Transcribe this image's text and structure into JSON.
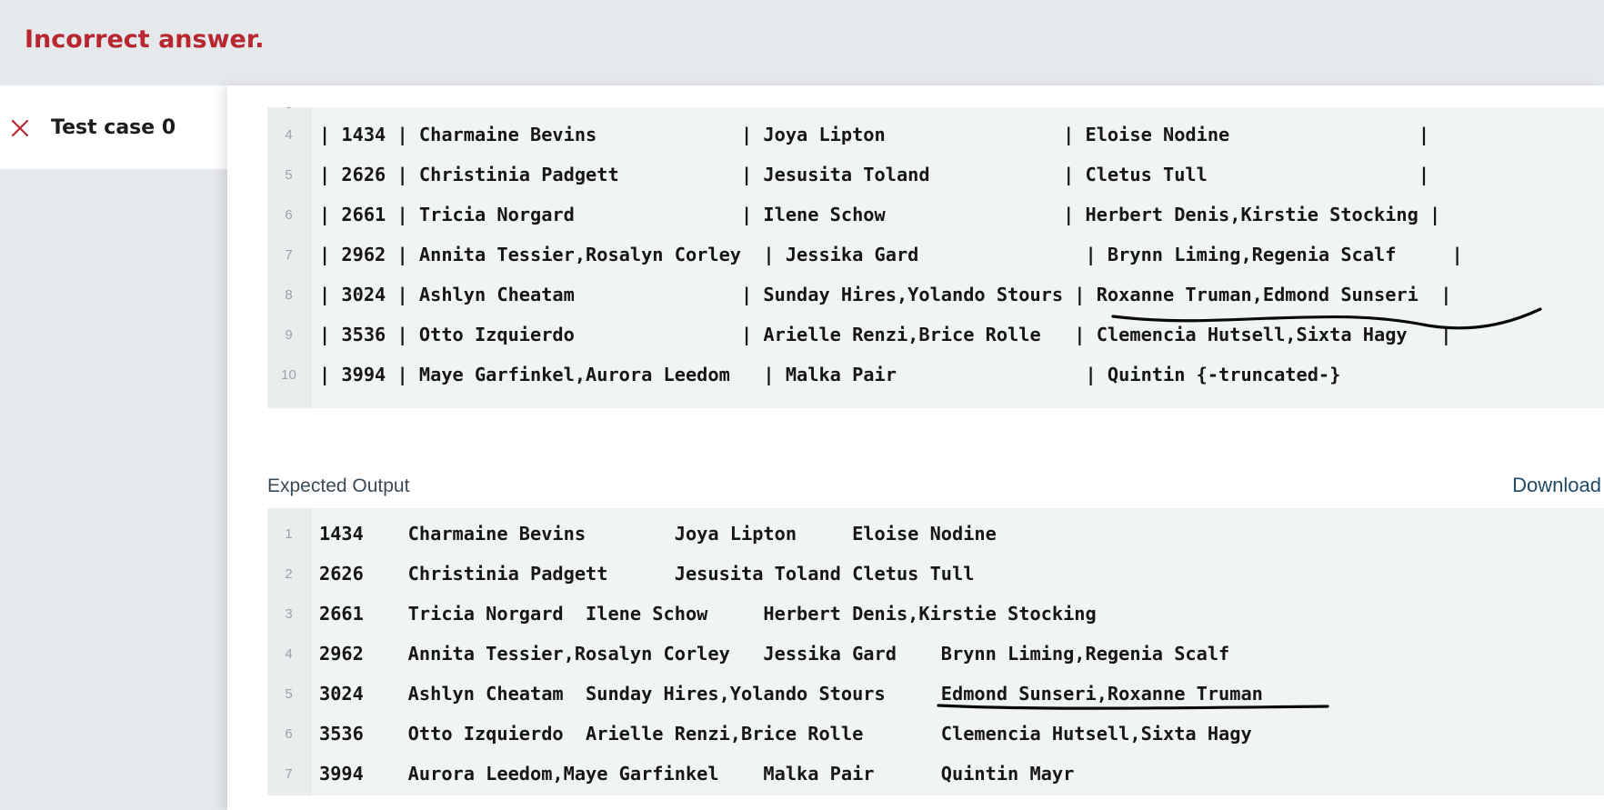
{
  "status": {
    "title": "Incorrect answer."
  },
  "sidebar": {
    "testcase_label": "Test case 0",
    "testcase_icon": "close-x-icon",
    "error_color": "#b8262f"
  },
  "your_output": {
    "partial_line_number": "3",
    "lines": [
      {
        "n": "4",
        "text": "| 1434 | Charmaine Bevins             | Joya Lipton                | Eloise Nodine                 |"
      },
      {
        "n": "5",
        "text": "| 2626 | Christinia Padgett           | Jesusita Toland            | Cletus Tull                   |"
      },
      {
        "n": "6",
        "text": "| 2661 | Tricia Norgard               | Ilene Schow                | Herbert Denis,Kirstie Stocking |"
      },
      {
        "n": "7",
        "text": "| 2962 | Annita Tessier,Rosalyn Corley  | Jessika Gard               | Brynn Liming,Regenia Scalf     |"
      },
      {
        "n": "8",
        "text": "| 3024 | Ashlyn Cheatam               | Sunday Hires,Yolando Stours | Roxanne Truman,Edmond Sunseri  |"
      },
      {
        "n": "9",
        "text": "| 3536 | Otto Izquierdo               | Arielle Renzi,Brice Rolle   | Clemencia Hutsell,Sixta Hagy   |"
      },
      {
        "n": "10",
        "text": "| 3994 | Maye Garfinkel,Aurora Leedom   | Malka Pair                 | Quintin {-truncated-}"
      }
    ]
  },
  "expected_output": {
    "label": "Expected Output",
    "download_label": "Download",
    "lines": [
      {
        "n": "1",
        "text": "1434    Charmaine Bevins        Joya Lipton     Eloise Nodine"
      },
      {
        "n": "2",
        "text": "2626    Christinia Padgett      Jesusita Toland Cletus Tull"
      },
      {
        "n": "3",
        "text": "2661    Tricia Norgard  Ilene Schow     Herbert Denis,Kirstie Stocking"
      },
      {
        "n": "4",
        "text": "2962    Annita Tessier,Rosalyn Corley   Jessika Gard    Brynn Liming,Regenia Scalf"
      },
      {
        "n": "5",
        "text": "3024    Ashlyn Cheatam  Sunday Hires,Yolando Stours     Edmond Sunseri,Roxanne Truman"
      },
      {
        "n": "6",
        "text": "3536    Otto Izquierdo  Arielle Renzi,Brice Rolle       Clemencia Hutsell,Sixta Hagy"
      },
      {
        "n": "7",
        "text": "3994    Aurora Leedom,Maye Garfinkel    Malka Pair      Quintin Mayr"
      }
    ]
  }
}
